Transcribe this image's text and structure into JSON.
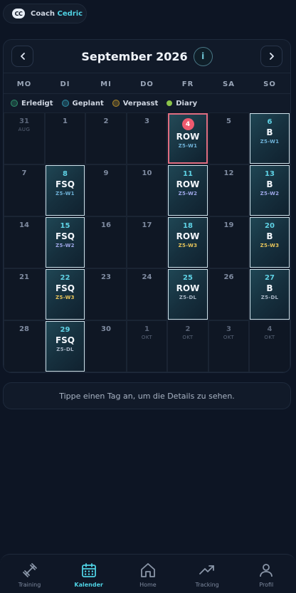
{
  "coach": {
    "badge": "CC",
    "prefix": "Coach",
    "name": "Cedric"
  },
  "calendar": {
    "title": "September 2026",
    "prev_icon": "chevron-left-icon",
    "next_icon": "chevron-right-icon",
    "info_icon": "info-icon",
    "info_glyph": "i",
    "weekdays": [
      "MO",
      "DI",
      "MI",
      "DO",
      "FR",
      "SA",
      "SO"
    ],
    "legend": [
      {
        "label": "Erledigt",
        "color": "#2f8f6b"
      },
      {
        "label": "Geplant",
        "color": "#2f8fa6"
      },
      {
        "label": "Verpasst",
        "color": "#b08a2a"
      },
      {
        "label": "Diary",
        "color": "#8bc34a"
      }
    ],
    "weeks": [
      [
        {
          "day": "31",
          "month": "AUG",
          "other": true
        },
        {
          "day": "1"
        },
        {
          "day": "2"
        },
        {
          "day": "3"
        },
        {
          "day": "4",
          "today": true,
          "planned": true,
          "workout": "ROW",
          "zone": "Z5-W1"
        },
        {
          "day": "5"
        },
        {
          "day": "6",
          "planned": true,
          "workout": "B",
          "zone": "Z5-W1"
        }
      ],
      [
        {
          "day": "7"
        },
        {
          "day": "8",
          "planned": true,
          "workout": "FSQ",
          "zone": "Z5-W1"
        },
        {
          "day": "9"
        },
        {
          "day": "10"
        },
        {
          "day": "11",
          "planned": true,
          "workout": "ROW",
          "zone": "Z5-W2"
        },
        {
          "day": "12"
        },
        {
          "day": "13",
          "planned": true,
          "workout": "B",
          "zone": "Z5-W2"
        }
      ],
      [
        {
          "day": "14"
        },
        {
          "day": "15",
          "planned": true,
          "workout": "FSQ",
          "zone": "Z5-W2"
        },
        {
          "day": "16"
        },
        {
          "day": "17"
        },
        {
          "day": "18",
          "planned": true,
          "workout": "ROW",
          "zone": "Z5-W3"
        },
        {
          "day": "19"
        },
        {
          "day": "20",
          "planned": true,
          "workout": "B",
          "zone": "Z5-W3"
        }
      ],
      [
        {
          "day": "21"
        },
        {
          "day": "22",
          "planned": true,
          "workout": "FSQ",
          "zone": "Z5-W3"
        },
        {
          "day": "23"
        },
        {
          "day": "24"
        },
        {
          "day": "25",
          "planned": true,
          "workout": "ROW",
          "zone": "Z5-DL"
        },
        {
          "day": "26"
        },
        {
          "day": "27",
          "planned": true,
          "workout": "B",
          "zone": "Z5-DL"
        }
      ],
      [
        {
          "day": "28"
        },
        {
          "day": "29",
          "planned": true,
          "workout": "FSQ",
          "zone": "Z5-DL"
        },
        {
          "day": "30"
        },
        {
          "day": "1",
          "month": "OKT",
          "other": true
        },
        {
          "day": "2",
          "month": "OKT",
          "other": true
        },
        {
          "day": "3",
          "month": "OKT",
          "other": true
        },
        {
          "day": "4",
          "month": "OKT",
          "other": true
        }
      ]
    ]
  },
  "hint": "Tippe einen Tag an, um die Details zu sehen.",
  "nav": [
    {
      "label": "Training",
      "icon": "dumbbell-icon",
      "active": false
    },
    {
      "label": "Kalender",
      "icon": "calendar-icon",
      "active": true
    },
    {
      "label": "Home",
      "icon": "home-icon",
      "active": false
    },
    {
      "label": "Tracking",
      "icon": "trend-chart-icon",
      "active": false
    },
    {
      "label": "Profil",
      "icon": "user-icon",
      "active": false
    }
  ]
}
